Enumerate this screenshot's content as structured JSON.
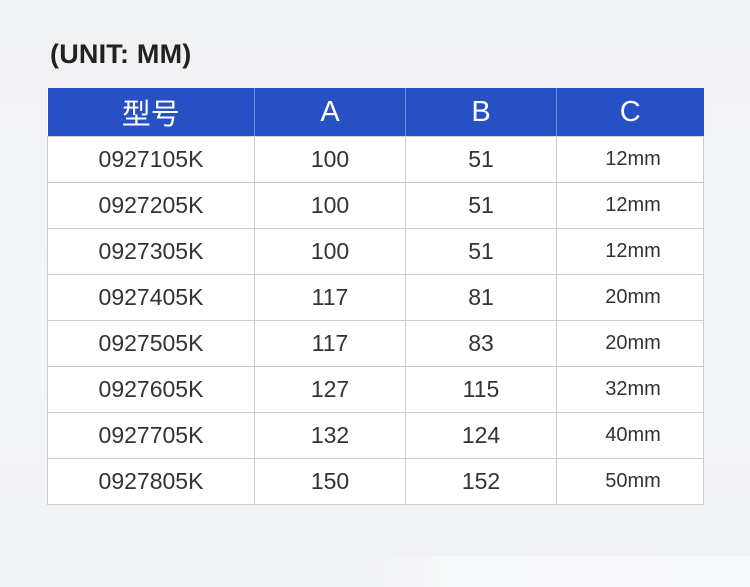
{
  "title": "(UNIT: MM)",
  "table": {
    "headers": [
      "型号",
      "A",
      "B",
      "C"
    ],
    "rows": [
      [
        "0927105K",
        "100",
        "51",
        "12mm"
      ],
      [
        "0927205K",
        "100",
        "51",
        "12mm"
      ],
      [
        "0927305K",
        "100",
        "51",
        "12mm"
      ],
      [
        "0927405K",
        "117",
        "81",
        "20mm"
      ],
      [
        "0927505K",
        "117",
        "83",
        "20mm"
      ],
      [
        "0927605K",
        "127",
        "115",
        "32mm"
      ],
      [
        "0927705K",
        "132",
        "124",
        "40mm"
      ],
      [
        "0927805K",
        "150",
        "152",
        "50mm"
      ]
    ]
  },
  "colors": {
    "header_background": "#2650c4",
    "header_text": "#ffffff",
    "cell_text": "#333333",
    "grid_lines": "#c9ccd1",
    "page_background": "#f2f3f5"
  }
}
